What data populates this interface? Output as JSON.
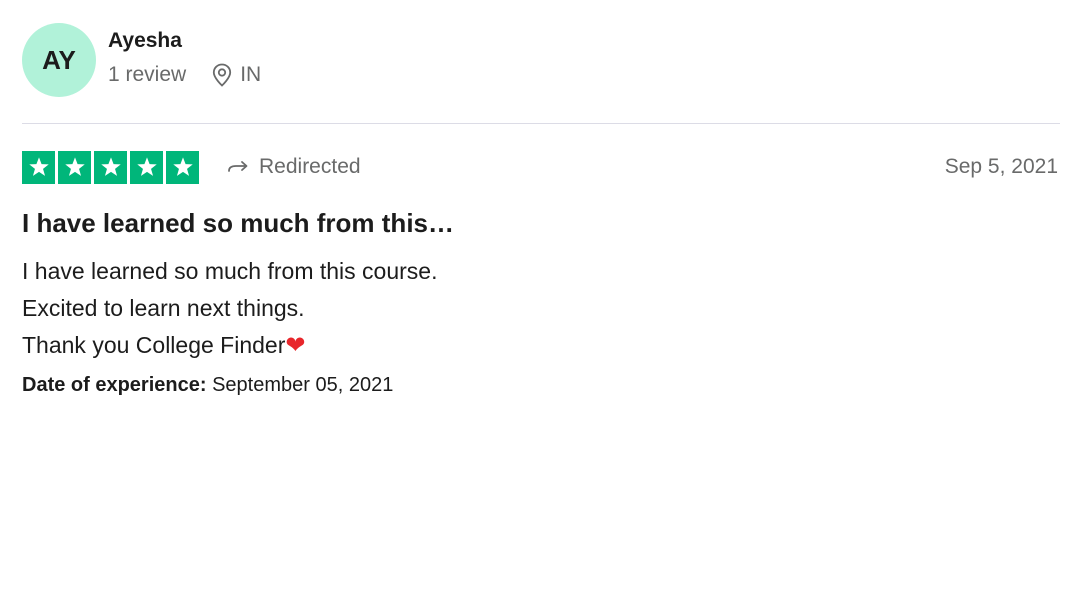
{
  "reviewer": {
    "initials": "AY",
    "name": "Ayesha",
    "review_count": "1 review",
    "country": "IN",
    "avatar_color": "#b1f2d9"
  },
  "rating": {
    "stars": 5,
    "max_stars": 5,
    "star_color": "#00b67a",
    "status_icon": "redirect-arrow-icon",
    "status_label": "Redirected",
    "date": "Sep 5, 2021"
  },
  "review": {
    "title": "I have learned so much from this…",
    "body_lines": [
      "I have learned so much from this course.",
      "Excited to learn next things.",
      "Thank you College Finder"
    ],
    "emoji": "❤",
    "experience_label": "Date of experience:",
    "experience_date": "September 05, 2021"
  }
}
